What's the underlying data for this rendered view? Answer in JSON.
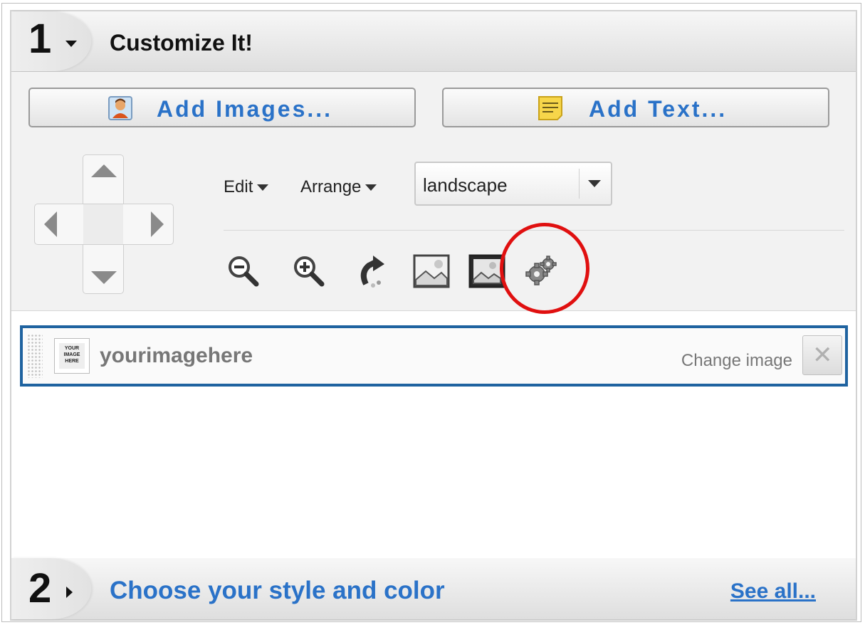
{
  "step1": {
    "number": "1",
    "title": "Customize It!"
  },
  "buttons": {
    "add_images": "Add Images...",
    "add_text": "Add Text..."
  },
  "menus": {
    "edit": "Edit",
    "arrange": "Arrange"
  },
  "orientation_select": {
    "value": "landscape"
  },
  "toolbar_icons": [
    "zoom-out-icon",
    "zoom-in-icon",
    "rotate-icon",
    "image-light-icon",
    "image-dark-icon",
    "gear-icon"
  ],
  "highlight_color": "#e01010",
  "layer": {
    "name": "yourimagehere",
    "thumb_text": "YOUR IMAGE HERE",
    "change_label": "Change image"
  },
  "step2": {
    "number": "2",
    "title": "Choose your style and color",
    "see_all": "See all..."
  },
  "accent_color": "#2a72c8"
}
